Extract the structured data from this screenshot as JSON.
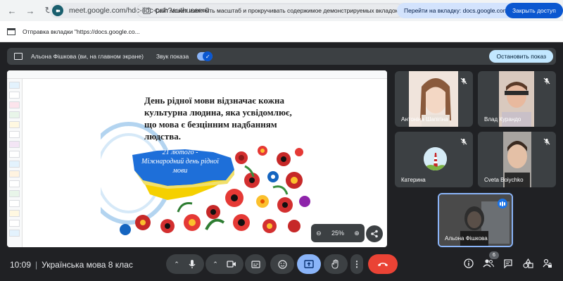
{
  "browser": {
    "url": "meet.google.com/hdc-iidc-pnh?authuser=0"
  },
  "sharing_bar": {
    "message": "Отправка вкладки \"https://docs.google.co...",
    "notice": "Сайт может изменять масштаб и прокручивать содержимое демонстрируемых вкладок",
    "goto_label": "Перейти на вкладку: docs.google.com",
    "stop_label": "Закрыть доступ"
  },
  "presenting_bar": {
    "presenter": "Альона Фішкова (ви, на главном экране)",
    "audio_label": "Звук показа",
    "stop_label": "Остановить показ"
  },
  "slide": {
    "text": "День рідної мови відзначає кожна культурна людина, яка усвідомлює, що мова є безцінним надбанням людства.",
    "map_date": "21 лютого -",
    "map_caption": "Міжнародний день рідної мови"
  },
  "zoom": {
    "value": "25%"
  },
  "participants": [
    {
      "name": "Антоніна Шапігіна"
    },
    {
      "name": "Влад Курандо"
    },
    {
      "name": "Катерина"
    },
    {
      "name": "Cveta Boiychko"
    }
  ],
  "self": {
    "name": "Альона Фішкова"
  },
  "meeting": {
    "time": "10:09",
    "title": "Українська мова 8 клас",
    "participant_count": "6"
  },
  "colors": {
    "end_call": "#ea4335",
    "present_active": "#8ab4f8",
    "accent": "#0b57d0"
  }
}
